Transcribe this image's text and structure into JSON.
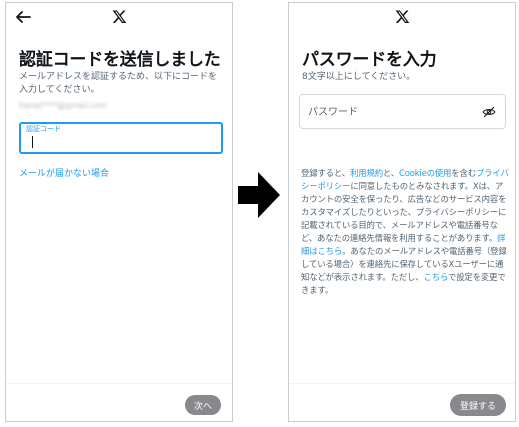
{
  "left_screen": {
    "back_icon": "left-arrow-icon",
    "logo_icon": "x-logo-icon",
    "heading": "認証コードを送信しました",
    "description": "メールアドレスを認証するため、以下にコードを入力してください。",
    "email": "hanaj****@gmail.com",
    "code_field": {
      "label": "認証コード",
      "value": ""
    },
    "no_email_link": "メールが届かない場合",
    "next_button": "次へ"
  },
  "right_screen": {
    "logo_icon": "x-logo-icon",
    "heading": "パスワードを入力",
    "description": "8文字以上にしてください。",
    "password_field": {
      "placeholder": "パスワード",
      "value": "",
      "icon": "eye-off-icon"
    },
    "terms": {
      "t1": "登録すると、",
      "link_terms": "利用規約",
      "t2": "と、",
      "link_cookie": "Cookieの使用",
      "t3": "を含む",
      "link_privacy": "プライバシーポリシー",
      "t4": "に同意したものとみなされます。Xは、アカウントの安全を保ったり、広告などのサービス内容をカスタマイズしたりといった、プライバシーポリシーに記載されている目的で、メールアドレスや電話番号など、あなたの連絡先情報を利用することがあります。",
      "link_details": "詳細はこちら",
      "t5": "。あなたのメールアドレスや電話番号（登録している場合）を連絡先に保存しているXユーザーに通知などが表示されます。ただし、",
      "link_here": "こちら",
      "t6": "で設定を変更できます。"
    },
    "register_button": "登録する"
  },
  "arrow_icon": "right-arrow-icon",
  "colors": {
    "accent": "#1d9bf0",
    "button_disabled": "#87898c",
    "text_primary": "#0f1419",
    "text_secondary": "#536471"
  }
}
